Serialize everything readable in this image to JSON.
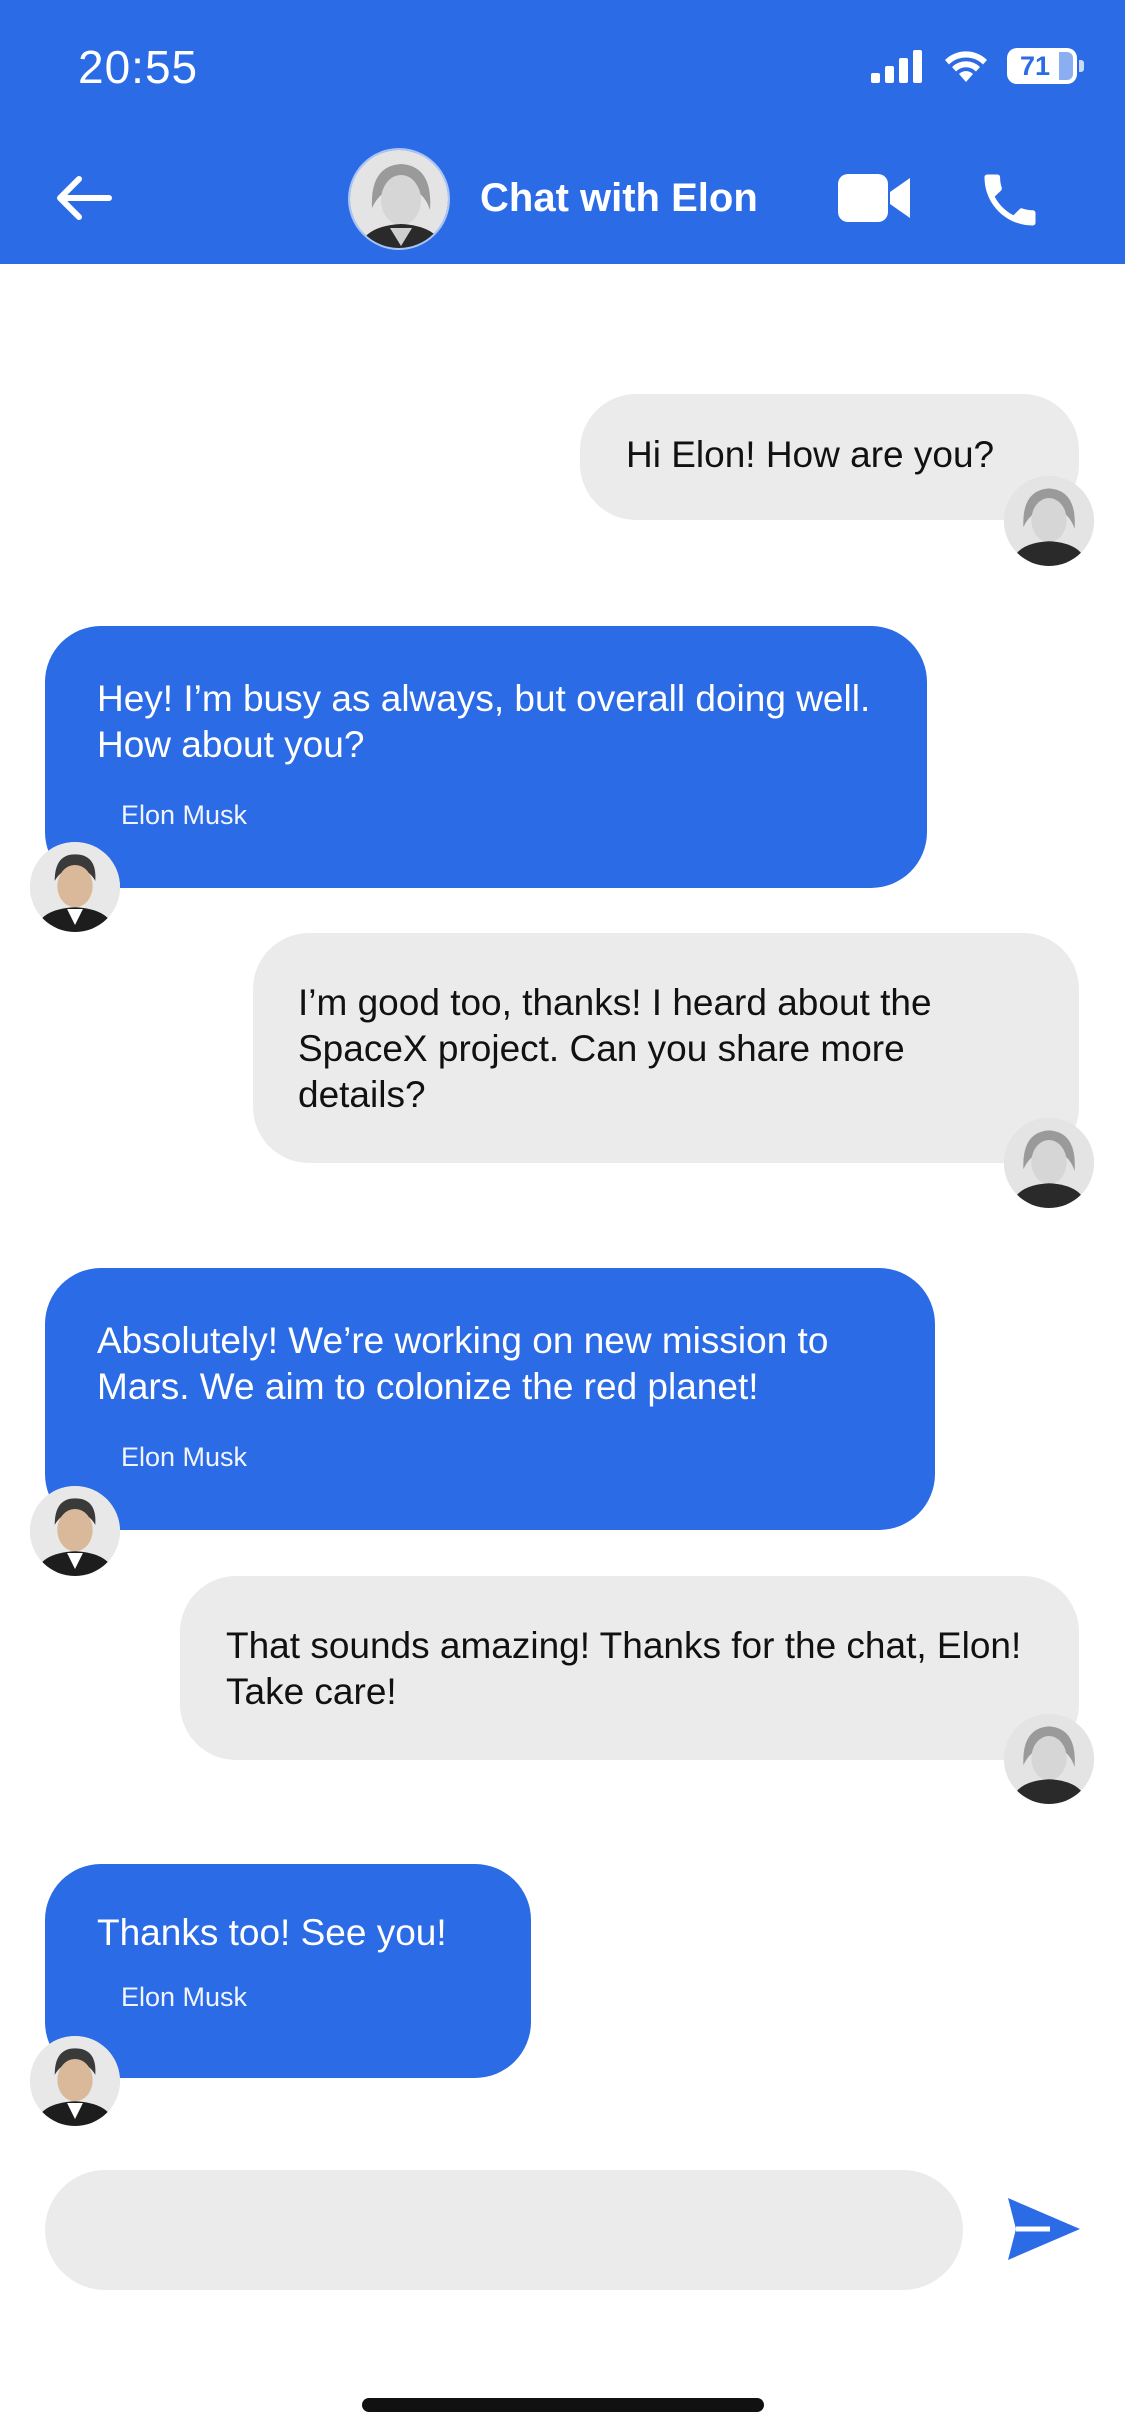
{
  "status_bar": {
    "time": "20:55",
    "battery": "71",
    "icons": [
      "signal-icon",
      "wifi-icon",
      "battery-icon"
    ]
  },
  "header": {
    "title": "Chat with Elon",
    "icons": [
      "back-arrow-icon",
      "video-camera-icon",
      "phone-icon"
    ]
  },
  "colors": {
    "accent": "#2b6be6",
    "outgoing_bubble": "#ebebeb",
    "incoming_text": "#ffffff"
  },
  "messages": [
    {
      "direction": "outgoing",
      "text": "Hi Elon! How are you?"
    },
    {
      "direction": "incoming",
      "text": "Hey! I’m busy as always, but overall doing well. How about you?",
      "sender": "Elon Musk"
    },
    {
      "direction": "outgoing",
      "text": "I’m good too, thanks! I heard about the SpaceX project. Can you share more details?"
    },
    {
      "direction": "incoming",
      "text": "Absolutely! We’re working on new mission to Mars. We aim to colonize the red planet!",
      "sender": "Elon Musk"
    },
    {
      "direction": "outgoing",
      "text": "That sounds amazing! Thanks for the chat, Elon! Take care!"
    },
    {
      "direction": "incoming",
      "text": "Thanks too! See you!",
      "sender": "Elon Musk"
    }
  ],
  "composer": {
    "value": "",
    "placeholder": ""
  }
}
